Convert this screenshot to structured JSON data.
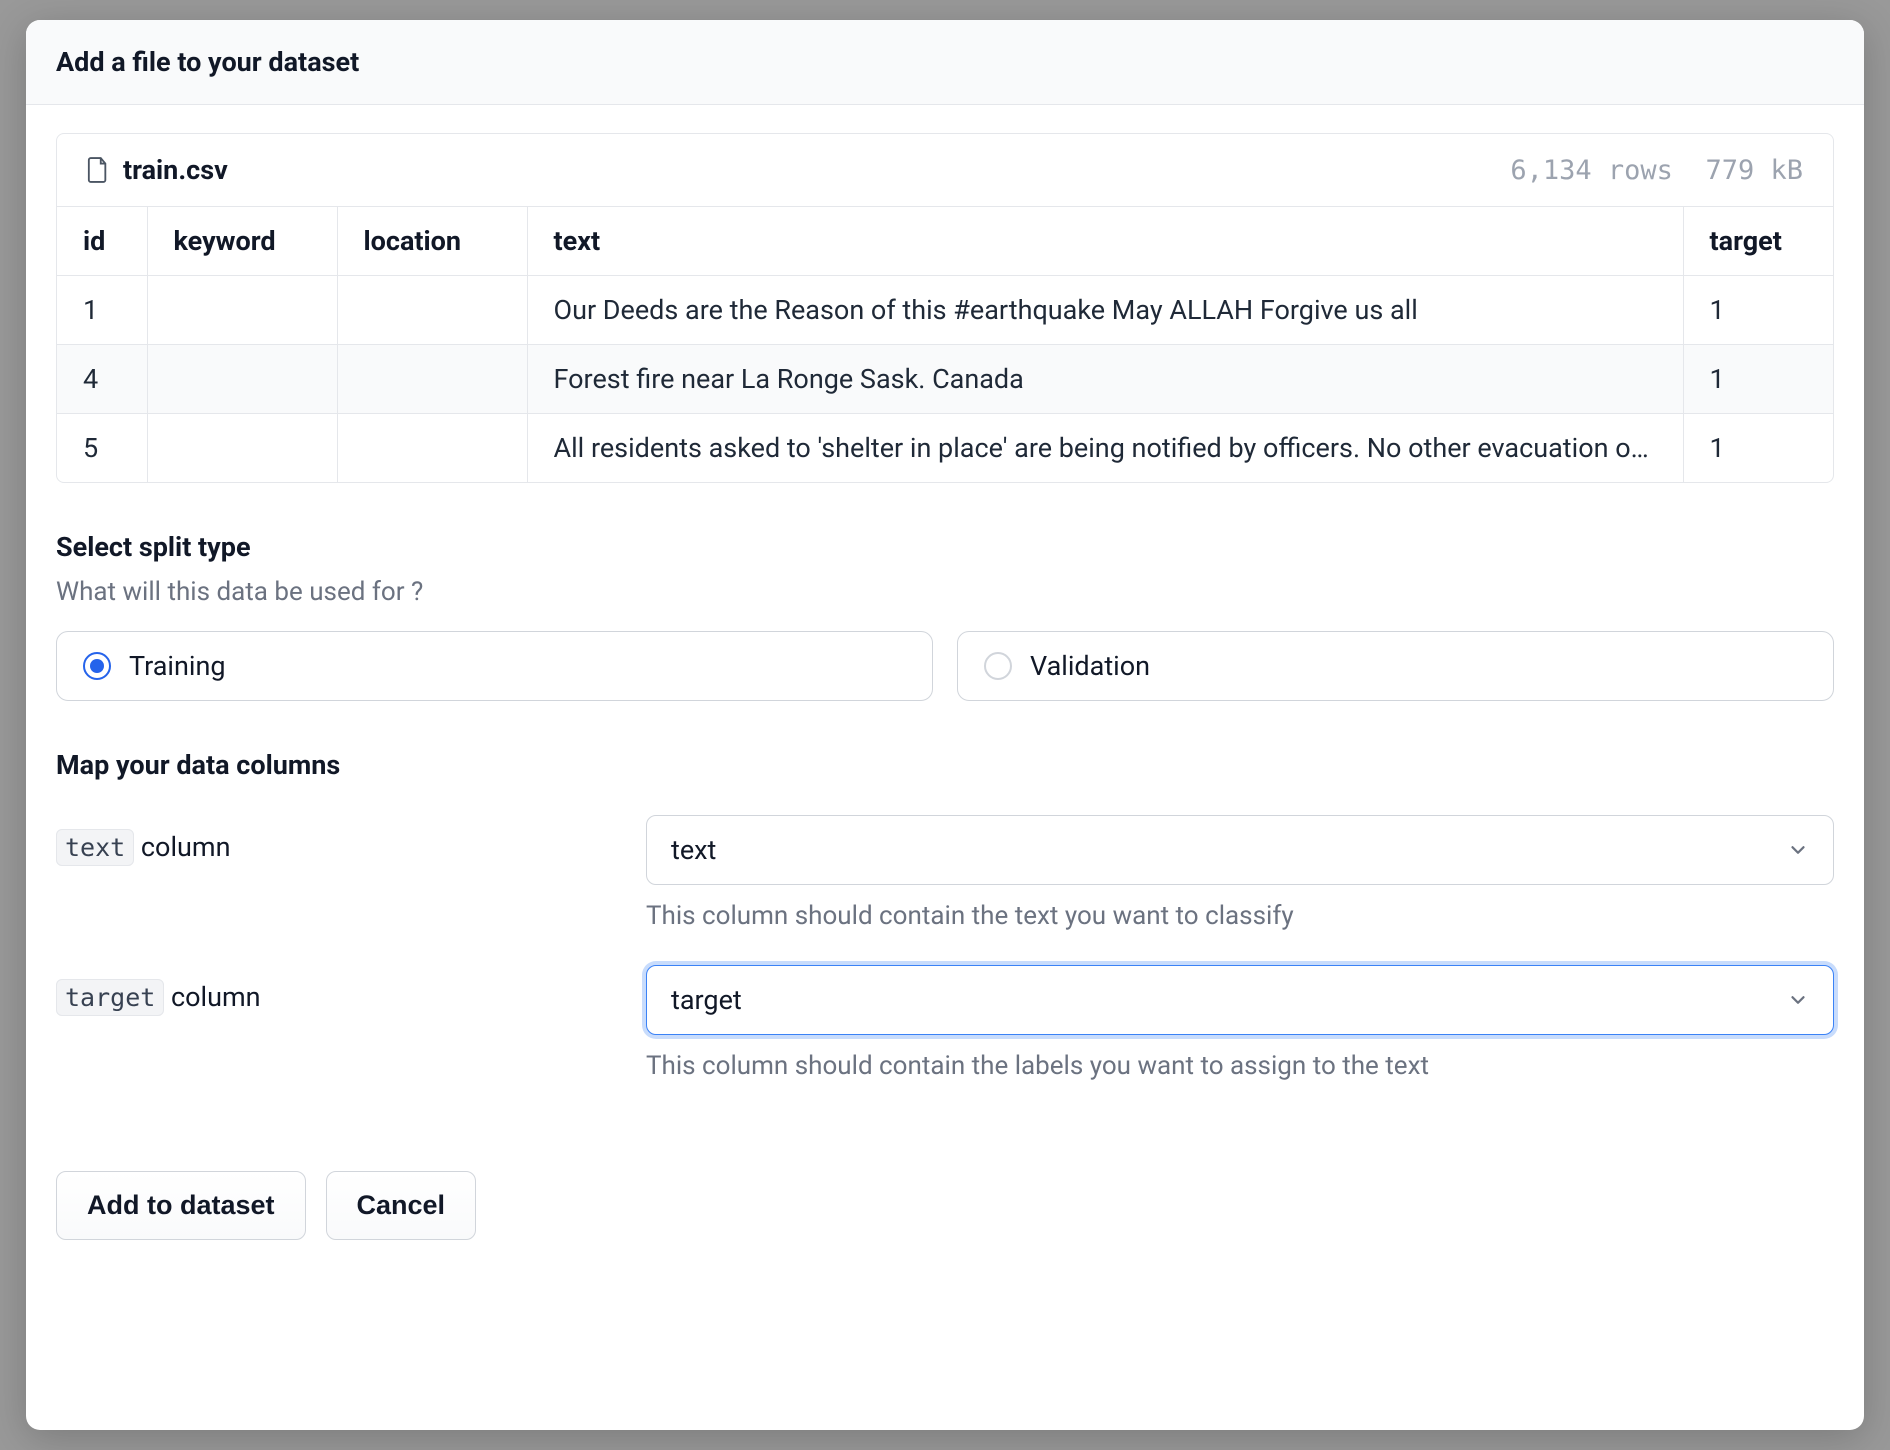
{
  "header": {
    "title": "Add a file to your dataset"
  },
  "file": {
    "name": "train.csv",
    "rows": "6,134 rows",
    "size": "779 kB"
  },
  "columns": {
    "c0": "id",
    "c1": "keyword",
    "c2": "location",
    "c3": "text",
    "c4": "target"
  },
  "rows": [
    {
      "id": "1",
      "keyword": "",
      "location": "",
      "text": "Our Deeds are the Reason of this #earthquake May ALLAH Forgive us all",
      "target": "1"
    },
    {
      "id": "4",
      "keyword": "",
      "location": "",
      "text": "Forest fire near La Ronge Sask. Canada",
      "target": "1"
    },
    {
      "id": "5",
      "keyword": "",
      "location": "",
      "text": "All residents asked to 'shelter in place' are being notified by officers. No other evacuation or shelter in place orders are expected",
      "target": "1"
    }
  ],
  "split": {
    "title": "Select split type",
    "sub": "What will this data be used for ?",
    "training": "Training",
    "validation": "Validation",
    "selected": "training"
  },
  "map": {
    "title": "Map your data columns",
    "text_code": "text",
    "text_suffix": " column",
    "text_value": "text",
    "text_help": "This column should contain the text you want to classify",
    "target_code": "target",
    "target_suffix": " column",
    "target_value": "target",
    "target_help": "This column should contain the labels you want to assign to the text"
  },
  "buttons": {
    "add": "Add to dataset",
    "cancel": "Cancel"
  }
}
